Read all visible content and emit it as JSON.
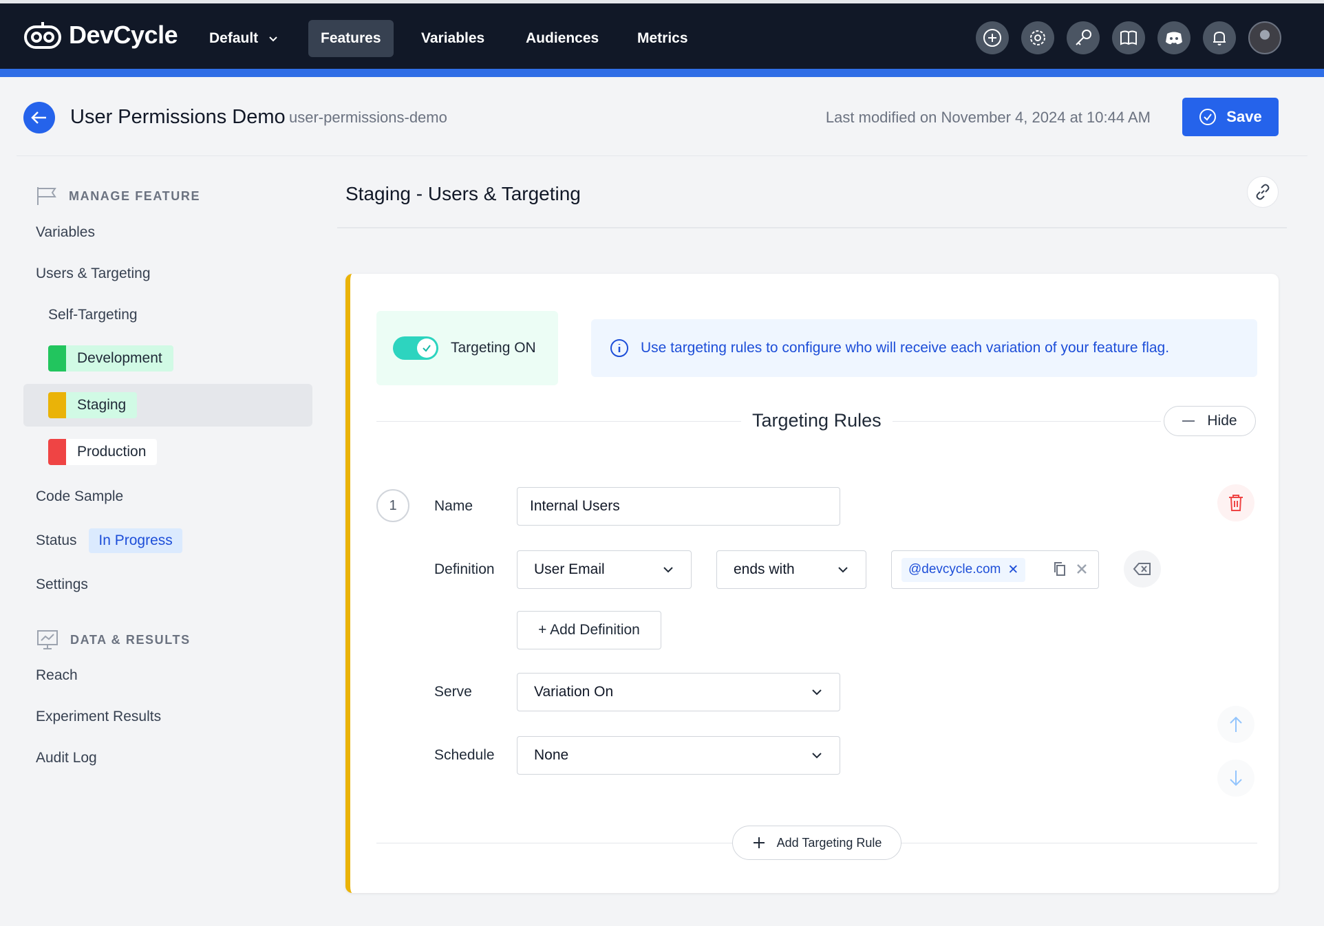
{
  "nav": {
    "brand": "DevCycle",
    "project": "Default",
    "items": [
      {
        "label": "Features",
        "active": true
      },
      {
        "label": "Variables",
        "active": false
      },
      {
        "label": "Audiences",
        "active": false
      },
      {
        "label": "Metrics",
        "active": false
      }
    ],
    "icons": [
      "plus-circle-icon",
      "gear-icon",
      "key-icon",
      "book-icon",
      "discord-icon",
      "bell-icon"
    ],
    "colors": {
      "background": "#111827",
      "accent": "#2f6ee6"
    }
  },
  "header": {
    "title": "User Permissions Demo",
    "key": "user-permissions-demo",
    "last_modified": "Last modified on November 4, 2024 at 10:44 AM",
    "save_label": "Save"
  },
  "sidebar": {
    "manage_heading": "MANAGE FEATURE",
    "variables": "Variables",
    "users_targeting": "Users & Targeting",
    "self_targeting": "Self-Targeting",
    "environments": [
      {
        "label": "Development",
        "color": "#22c55e",
        "bg": "#d1fae5"
      },
      {
        "label": "Staging",
        "color": "#eab308",
        "bg": "#d1fae5",
        "active": true
      },
      {
        "label": "Production",
        "color": "#ef4444",
        "bg": "#ffffff"
      }
    ],
    "code_sample": "Code Sample",
    "status_label": "Status",
    "status_value": "In Progress",
    "settings": "Settings",
    "data_heading": "DATA & RESULTS",
    "reach": "Reach",
    "experiment_results": "Experiment Results",
    "audit_log": "Audit Log"
  },
  "main": {
    "section_title": "Staging - Users & Targeting",
    "targeting_toggle_label": "Targeting ON",
    "targeting_on": true,
    "info_text": "Use targeting rules to configure who will receive each variation of your feature flag.",
    "rules_title": "Targeting Rules",
    "hide_label": "Hide",
    "rule": {
      "number": "1",
      "name_label": "Name",
      "name_value": "Internal Users",
      "definition_label": "Definition",
      "property": "User Email",
      "operator": "ends with",
      "values": [
        "@devcycle.com"
      ],
      "add_definition": "+ Add Definition",
      "serve_label": "Serve",
      "serve_value": "Variation On",
      "schedule_label": "Schedule",
      "schedule_value": "None"
    },
    "add_rule_label": "Add Targeting Rule"
  }
}
